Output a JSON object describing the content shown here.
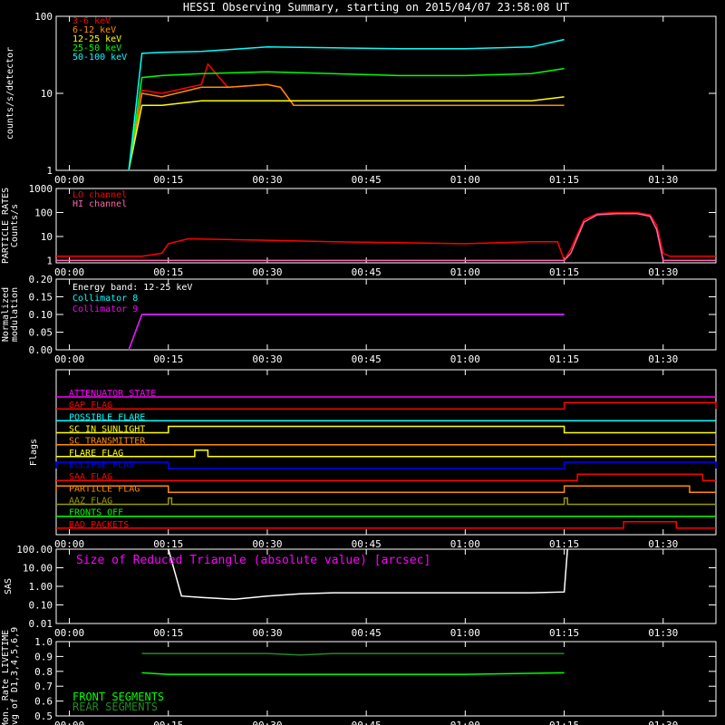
{
  "chart_data": {
    "title": "HESSI Observing Summary, starting on 2015/04/07 23:58:08 UT",
    "x_tick_labels": [
      "00:00",
      "00:15",
      "00:30",
      "00:45",
      "01:00",
      "01:15",
      "01:30"
    ],
    "x_ticks_minutes": [
      0,
      15,
      30,
      45,
      60,
      75,
      90
    ],
    "xlim_minutes": [
      -2,
      98
    ],
    "panels": [
      {
        "id": "rates",
        "type": "line",
        "ylabel": "counts/s/detector",
        "yscale": "log",
        "ylim": [
          1,
          100
        ],
        "y_tick_labels": [
          "1",
          "10",
          "100"
        ],
        "y_ticks": [
          1,
          10,
          100
        ],
        "series": [
          {
            "name": "3-6 keV",
            "color": "#ff0000",
            "x": [
              9,
              11,
              14,
              20,
              21,
              24,
              30,
              32,
              34,
              40,
              50,
              60,
              70,
              75
            ],
            "y": [
              1,
              11,
              10,
              13,
              24,
              12,
              13,
              12,
              7,
              7,
              7,
              7,
              7,
              7
            ]
          },
          {
            "name": "6-12 keV",
            "color": "#ff8c00",
            "x": [
              9,
              11,
              14,
              20,
              24,
              30,
              32,
              34,
              40,
              50,
              60,
              70,
              75
            ],
            "y": [
              1,
              10,
              9,
              12,
              12,
              13,
              12,
              7,
              7,
              7,
              7,
              7,
              7
            ]
          },
          {
            "name": "12-25 keV",
            "color": "#ffff00",
            "x": [
              9,
              11,
              14,
              20,
              24,
              30,
              35,
              40,
              50,
              60,
              70,
              75
            ],
            "y": [
              1,
              7,
              7,
              8,
              8,
              8,
              8,
              8,
              8,
              8,
              8,
              9
            ]
          },
          {
            "name": "25-50 keV",
            "color": "#00ff00",
            "x": [
              9,
              11,
              14,
              20,
              30,
              40,
              50,
              60,
              70,
              75
            ],
            "y": [
              1,
              16,
              17,
              18,
              19,
              18,
              17,
              17,
              18,
              21
            ]
          },
          {
            "name": "50-100 keV",
            "color": "#00ffff",
            "x": [
              9,
              11,
              14,
              20,
              30,
              40,
              50,
              60,
              70,
              75
            ],
            "y": [
              1,
              33,
              34,
              35,
              40,
              39,
              38,
              38,
              40,
              50
            ]
          }
        ]
      },
      {
        "id": "particle",
        "type": "line",
        "ylabel": "PARTICLE RATES Counts/s",
        "yscale": "log",
        "ylim": [
          0.8,
          1000
        ],
        "y_tick_labels": [
          "1",
          "10",
          "100",
          "1000"
        ],
        "y_ticks": [
          1,
          10,
          100,
          1000
        ],
        "series": [
          {
            "name": "LO channel",
            "color": "#ff0000",
            "x": [
              -2,
              11,
              14,
              15,
              18,
              30,
              40,
              50,
              60,
              70,
              74,
              75,
              76,
              78,
              80,
              83,
              86,
              88,
              89,
              90,
              91,
              93,
              98
            ],
            "y": [
              1.5,
              1.5,
              2,
              5,
              8,
              7,
              6,
              5.5,
              5,
              6,
              6,
              1,
              3,
              50,
              90,
              100,
              100,
              80,
              30,
              2,
              1.5,
              1.5,
              1.5
            ]
          },
          {
            "name": "HI channel",
            "color": "#ff66aa",
            "x": [
              -2,
              74,
              75,
              76,
              78,
              80,
              83,
              86,
              88,
              89,
              90,
              98
            ],
            "y": [
              1,
              1,
              1,
              2,
              40,
              80,
              90,
              90,
              70,
              20,
              1,
              1
            ]
          }
        ]
      },
      {
        "id": "modulation",
        "type": "line",
        "ylabel": "Normalized modulation",
        "ylim": [
          0,
          0.2
        ],
        "y_tick_labels": [
          "0.00",
          "0.05",
          "0.10",
          "0.15",
          "0.20"
        ],
        "y_ticks": [
          0,
          0.05,
          0.1,
          0.15,
          0.2
        ],
        "annotation": "Energy band: 12-25 keV",
        "series": [
          {
            "name": "Collimator 8",
            "color": "#00ffff",
            "x": [
              9,
              11,
              75
            ],
            "y": [
              0,
              0.1,
              0.1
            ]
          },
          {
            "name": "Collimator 9",
            "color": "#ff00ff",
            "x": [
              9,
              11,
              75
            ],
            "y": [
              0,
              0.1,
              0.1
            ]
          }
        ]
      },
      {
        "id": "flags",
        "type": "line",
        "ylabel": "Flags",
        "flags": [
          {
            "name": "ATTENUATOR STATE",
            "color": "#ff00ff"
          },
          {
            "name": "GAP FLAG",
            "color": "#ff0000",
            "high": [
              [
                75,
                98
              ]
            ]
          },
          {
            "name": "POSSIBLE FLARE",
            "color": "#00ffff"
          },
          {
            "name": "SC IN SUNLIGHT",
            "color": "#ffff00",
            "high": [
              [
                15,
                75
              ]
            ]
          },
          {
            "name": "SC TRANSMITTER",
            "color": "#ff8c00"
          },
          {
            "name": "FLARE FLAG",
            "color": "#ffff00",
            "high": [
              [
                19,
                21
              ]
            ]
          },
          {
            "name": "ECLIPSE FLAG",
            "color": "#0000ff",
            "high": [
              [
                -2,
                15
              ],
              [
                75,
                98
              ]
            ]
          },
          {
            "name": "SAA FLAG",
            "color": "#ff0000",
            "high": [
              [
                77,
                96
              ]
            ]
          },
          {
            "name": "PARTICLE FLAG",
            "color": "#ff8c00",
            "high": [
              [
                -2,
                15
              ],
              [
                75,
                94
              ]
            ]
          },
          {
            "name": "AAZ FLAG",
            "color": "#999900",
            "high": [
              [
                15,
                15.5
              ],
              [
                75,
                75.5
              ]
            ]
          },
          {
            "name": "FRONTS OFF",
            "color": "#00ff00"
          },
          {
            "name": "BAD PACKETS",
            "color": "#ff0000",
            "high": [
              [
                84,
                92
              ]
            ]
          }
        ]
      },
      {
        "id": "sas",
        "type": "line",
        "ylabel": "SAS",
        "yscale": "log",
        "ylim": [
          0.01,
          100
        ],
        "y_tick_labels": [
          "0.01",
          "0.10",
          "1.00",
          "10.00",
          "100.00"
        ],
        "y_ticks": [
          0.01,
          0.1,
          1,
          10,
          100
        ],
        "annotation": "Size of Reduced Triangle (absolute value) [arcsec]",
        "series": [
          {
            "name": "",
            "color": "#ffffff",
            "x": [
              15,
              17,
              20,
              25,
              30,
              35,
              40,
              50,
              60,
              70,
              75,
              75.5
            ],
            "y": [
              100,
              0.3,
              0.25,
              0.2,
              0.3,
              0.4,
              0.45,
              0.45,
              0.45,
              0.45,
              0.5,
              100
            ]
          }
        ]
      },
      {
        "id": "livetime",
        "type": "line",
        "ylabel": "Mon. Rate LIVETIME avg of D1,3,4,5,6,9",
        "ylim": [
          0.5,
          1.0
        ],
        "y_tick_labels": [
          "0.5",
          "0.6",
          "0.7",
          "0.8",
          "0.9",
          "1.0"
        ],
        "y_ticks": [
          0.5,
          0.6,
          0.7,
          0.8,
          0.9,
          1.0
        ],
        "series": [
          {
            "name": "FRONT SEGMENTS",
            "color": "#00ff00",
            "x": [
              11,
              15,
              30,
              45,
              60,
              75
            ],
            "y": [
              0.79,
              0.78,
              0.78,
              0.78,
              0.78,
              0.79
            ]
          },
          {
            "name": "REAR SEGMENTS",
            "color": "#228b22",
            "x": [
              11,
              30,
              35,
              40,
              45,
              60,
              75
            ],
            "y": [
              0.92,
              0.92,
              0.91,
              0.92,
              0.92,
              0.92,
              0.92
            ]
          }
        ]
      }
    ]
  }
}
